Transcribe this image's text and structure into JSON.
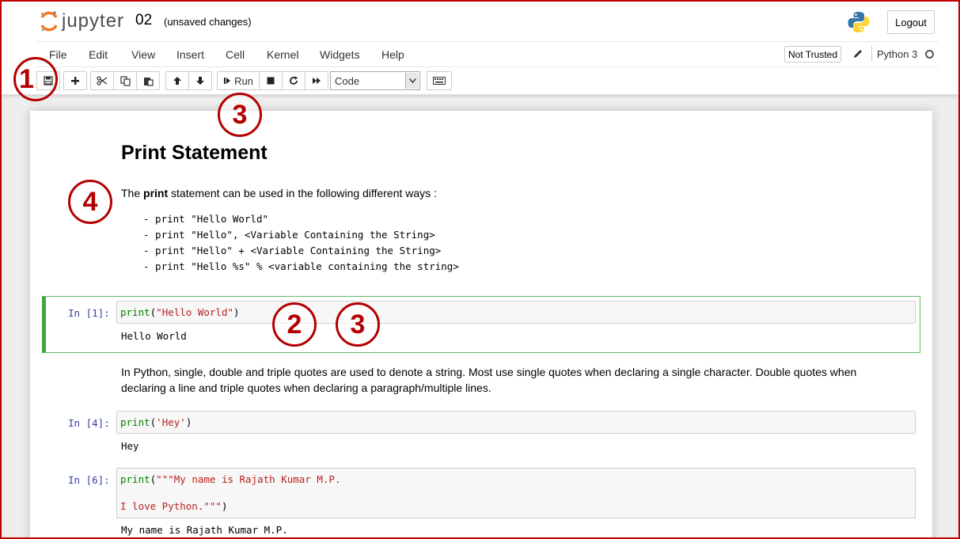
{
  "header": {
    "logo_text": "jupyter",
    "notebook_name": "02",
    "save_status": "(unsaved changes)",
    "logout_label": "Logout"
  },
  "menu": {
    "items": [
      "File",
      "Edit",
      "View",
      "Insert",
      "Cell",
      "Kernel",
      "Widgets",
      "Help"
    ],
    "trusted_label": "Not Trusted",
    "kernel_name": "Python 3"
  },
  "toolbar": {
    "run_label": "Run",
    "cell_type": "Code"
  },
  "annotations": [
    "1",
    "3",
    "4",
    "2",
    "3"
  ],
  "markdown1": {
    "title": "Print Statement",
    "intro_prefix": "The ",
    "intro_bold": "print",
    "intro_suffix": " statement can be used in the following different ways :",
    "list": [
      "- print \"Hello World\"",
      "- print \"Hello\", <Variable Containing the String>",
      "- print \"Hello\" + <Variable Containing the String>",
      "- print \"Hello %s\" % <variable containing the string>"
    ]
  },
  "cells": [
    {
      "prompt": "In [1]:",
      "code_fn": "print",
      "code_open": "(",
      "code_str": "\"Hello World\"",
      "code_close": ")",
      "output": "Hello World"
    },
    {
      "prompt": "In [4]:",
      "code_fn": "print",
      "code_open": "(",
      "code_str": "'Hey'",
      "code_close": ")",
      "output": "Hey"
    },
    {
      "prompt": "In [6]:",
      "code_fn": "print",
      "code_open": "(",
      "code_str": "\"\"\"My name is Rajath Kumar M.P.",
      "code_str2": "I love Python.\"\"\"",
      "code_close": ")",
      "output": "My name is Rajath Kumar M.P."
    }
  ],
  "markdown2": {
    "line1": "In Python, single, double and triple quotes are used to denote a string. Most use single quotes when declaring a single character. Double quotes when",
    "line2": "declaring a line and triple quotes when declaring a paragraph/multiple lines."
  },
  "colors": {
    "annotation": "#b40000",
    "selected_cell_border": "#42a545",
    "prompt": "#303f9f",
    "keyword": "#008000",
    "string": "#ba2121"
  }
}
